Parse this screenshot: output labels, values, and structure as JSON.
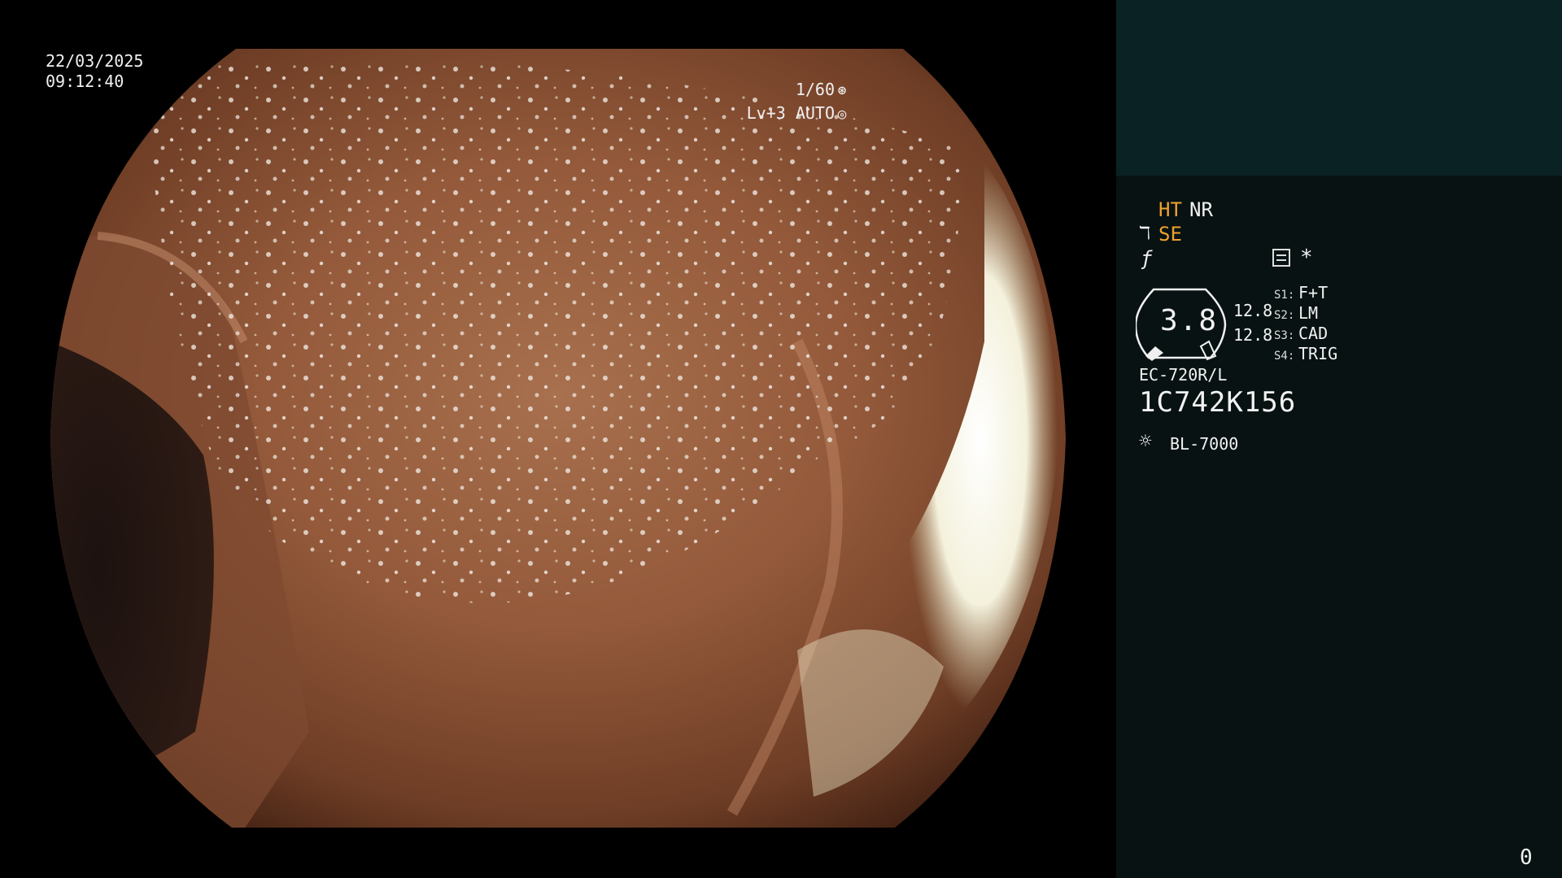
{
  "overlay": {
    "date": "22/03/2025",
    "time": "09:12:40",
    "shutter": "1/60",
    "shutter_icon": "shutter-icon",
    "level": "Lv+3 AUTO",
    "auto_icon": "iris-icon"
  },
  "panel": {
    "ht_label": "HT",
    "nr_label": "NR",
    "se_label": "SE",
    "se_icon": "enhance-curve-icon",
    "f_icon": "f-slash-icon",
    "menu_icon": "menu-icon",
    "asterisk": "*",
    "gauge_value": "3.8",
    "value_1": "12.8",
    "value_2": "12.8",
    "switches": [
      {
        "label": "S1:",
        "value": "F+T"
      },
      {
        "label": "S2:",
        "value": "LM"
      },
      {
        "label": "S3:",
        "value": "CAD"
      },
      {
        "label": "S4:",
        "value": "TRIG"
      }
    ],
    "scope_model": "EC-720R/L",
    "serial": "1C742K156",
    "light_icon": "sun-icon",
    "light_source": "BL-7000",
    "counter": "0"
  },
  "colors": {
    "panel_bg": "#081212",
    "panel_top_bg": "#0b2224",
    "accent_amber": "#f0a030"
  }
}
